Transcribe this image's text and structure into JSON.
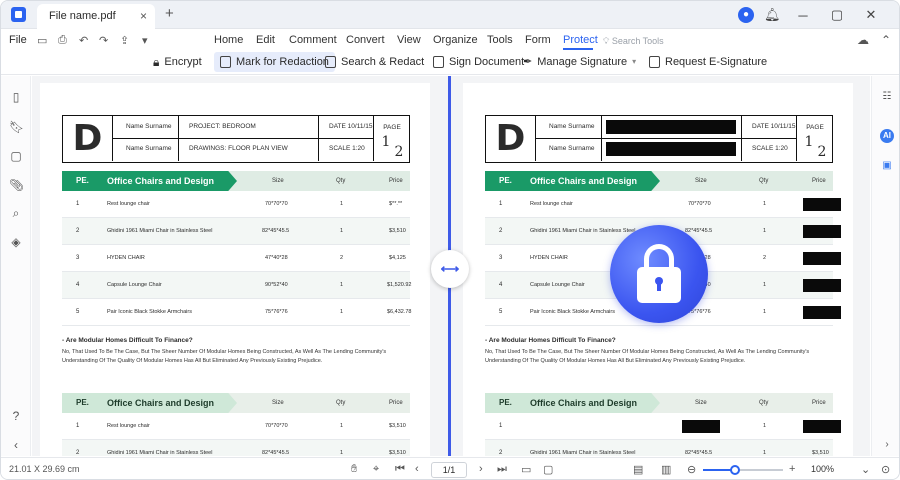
{
  "titlebar": {
    "tab_title": "File name.pdf",
    "close_symbol": "×",
    "add_symbol": "+",
    "avatar_letter": "👤",
    "controls": [
      "─",
      "▢",
      "✕"
    ]
  },
  "menu": {
    "file": "File",
    "items": [
      "Home",
      "Edit",
      "Comment",
      "Convert",
      "View",
      "Organize",
      "Tools",
      "Form",
      "Protect"
    ],
    "active": "Protect",
    "search_placeholder": "Search Tools"
  },
  "toolbar": {
    "encrypt": "Encrypt",
    "mark_redaction": "Mark for Redaction",
    "search_redact": "Search & Redact",
    "sign_document": "Sign Document",
    "manage_signature": "Manage Signature",
    "request_esignature": "Request E-Signature"
  },
  "document": {
    "logo_letter": "D",
    "name_label": "Name Surname",
    "project": "PROJECT: BEDROOM",
    "drawings": "DRAWINGS: FLOOR PLAN VIEW",
    "date": "DATE 10/11/15",
    "scale": "SCALE 1:20",
    "page_label": "PAGE",
    "page_num": "1",
    "page_total": "2",
    "table1_title": "Office Chairs and Design",
    "table2_title": "Office Chairs and Design",
    "pe": "PE.",
    "col_size": "Size",
    "col_qty": "Qty",
    "col_price": "Price",
    "rows": [
      {
        "num": "1",
        "name": "Rest lounge chair",
        "size": "70*70*70",
        "qty": "1",
        "price": "$**.**"
      },
      {
        "num": "2",
        "name": "Ghidini 1961 Miami Chair in Stainless Steel",
        "size": "82*45*45.5",
        "qty": "1",
        "price": "$3,510"
      },
      {
        "num": "3",
        "name": "HYDEN CHAIR",
        "size": "47*40*28",
        "qty": "2",
        "price": "$4,125"
      },
      {
        "num": "4",
        "name": "Capsule Lounge Chair",
        "size": "90*52*40",
        "qty": "1",
        "price": "$1,520.92"
      },
      {
        "num": "5",
        "name": "Pair Iconic Black Stokke Armchairs",
        "size": "75*76*76",
        "qty": "1",
        "price": "$6,432.78"
      }
    ],
    "rows2": [
      {
        "num": "1",
        "name": "Rest lounge chair",
        "size": "70*70*70",
        "qty": "1",
        "price": "$3,510"
      },
      {
        "num": "2",
        "name": "Ghidini 1961 Miami Chair in Stainless Steel",
        "size": "82*45*45.5",
        "qty": "1",
        "price": "$3,510"
      }
    ],
    "question_title": "- Are Modular Homes Difficult To Finance?",
    "question_text": "No, That Used To Be The Case, But The Sheer Number Of Modular Homes Being Constructed, As Well As The Lending Community's Understanding Of The Quality Of Modular Homes Has All But Eliminated Any Previously Existing Prejudice."
  },
  "statusbar": {
    "dimensions": "21.01 X 29.69 cm",
    "page_indicator": "1/1",
    "zoom": "100%",
    "zoom_level": 0.4
  }
}
